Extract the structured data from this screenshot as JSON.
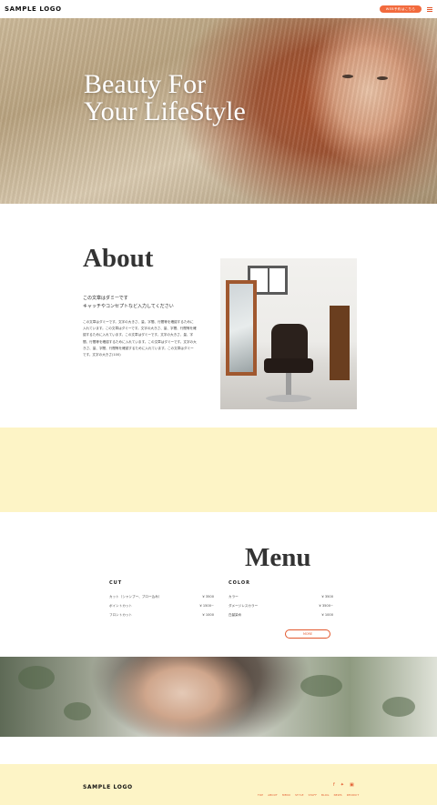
{
  "header": {
    "logo": "SAMPLE LOGO",
    "reserve_label": "WEB予約はこちら",
    "menu_icon": "hamburger-icon"
  },
  "hero": {
    "title_line1": "Beauty For",
    "title_line2": "Your LifeStyle"
  },
  "about": {
    "title": "About",
    "lead_line1": "この文章はダミーです",
    "lead_line2": "キャッチやコンセプトなど入力してください",
    "body": "この文章はダミーです。文字の大きさ、量、字間、行間等を確認するために入れています。この文章はダミーです。文字の大きさ、量、字間、行間等を確認するために入れています。この文章はダミーです。文字の大きさ、量、字間、行間等を確認するために入れています。この文章はダミーです。文字の大きさ、量、字間、行間等を確認するために入れています。この文章はダミーです。文字の大きさ(100)"
  },
  "menu": {
    "title": "Menu",
    "cut": {
      "heading": "CUT",
      "items": [
        {
          "name": "カット（シャンプー、ブロー込み）",
          "price": "¥ 3500"
        },
        {
          "name": "ポイントカット",
          "price": "¥ 1500~"
        },
        {
          "name": "フロントカット",
          "price": "¥ 1000"
        }
      ]
    },
    "color": {
      "heading": "COLOR",
      "items": [
        {
          "name": "カラー",
          "price": "¥ 3500"
        },
        {
          "name": "ダメージレスカラー",
          "price": "¥ 3500~"
        },
        {
          "name": "白髪染め",
          "price": "¥ 1000"
        }
      ]
    },
    "more_label": "MORE"
  },
  "footer": {
    "logo": "SAMPLE LOGO",
    "social": [
      "facebook-icon",
      "twitter-icon",
      "instagram-icon"
    ],
    "nav": [
      "TOP",
      "ABOUT",
      "MENU",
      "STYLE",
      "STAFF",
      "BLOG",
      "NEWS",
      "RECRUIT"
    ]
  },
  "colors": {
    "accent": "#e2572c",
    "reserve_bg": "#f26a3d",
    "band": "#fdf4c6"
  }
}
